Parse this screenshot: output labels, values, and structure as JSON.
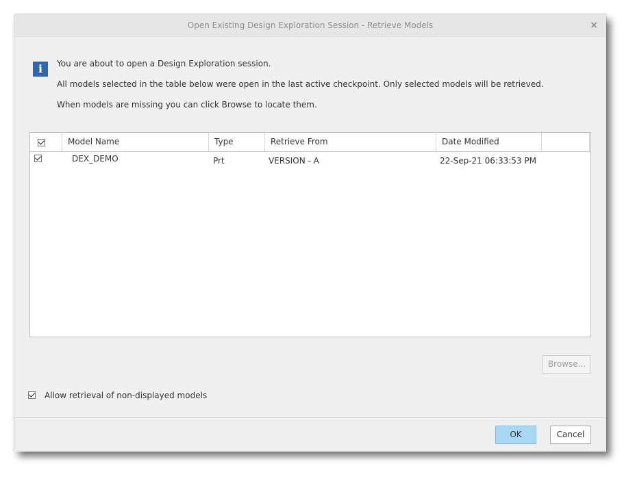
{
  "dialog": {
    "title": "Open Existing Design Exploration Session - Retrieve Models",
    "close_glyph": "×",
    "info_icon": "i",
    "messages": {
      "line1": "You are about to open a Design Exploration session.",
      "line2": "All models selected in the table below were open in the last active checkpoint. Only selected models will be retrieved.",
      "line3": "When models are missing you can click Browse to locate them."
    }
  },
  "table": {
    "columns": {
      "model_name": "Model Name",
      "type": "Type",
      "retrieve_from": "Retrieve From",
      "date_modified": "Date Modified"
    },
    "select_all_checked": true,
    "rows": [
      {
        "checked": true,
        "model_name": "DEX_DEMO",
        "type": "Prt",
        "retrieve_from": "VERSION - A",
        "date_modified": "22-Sep-21 06:33:53 PM"
      }
    ]
  },
  "buttons": {
    "browse": "Browse...",
    "ok": "OK",
    "cancel": "Cancel"
  },
  "options": {
    "allow_retrieval_label": "Allow retrieval of non-displayed models",
    "allow_retrieval_checked": true
  },
  "colors": {
    "info_icon_bg": "#2f66ac",
    "ok_button_bg": "#a9d8f5",
    "dialog_bg": "#f0f0f0"
  }
}
